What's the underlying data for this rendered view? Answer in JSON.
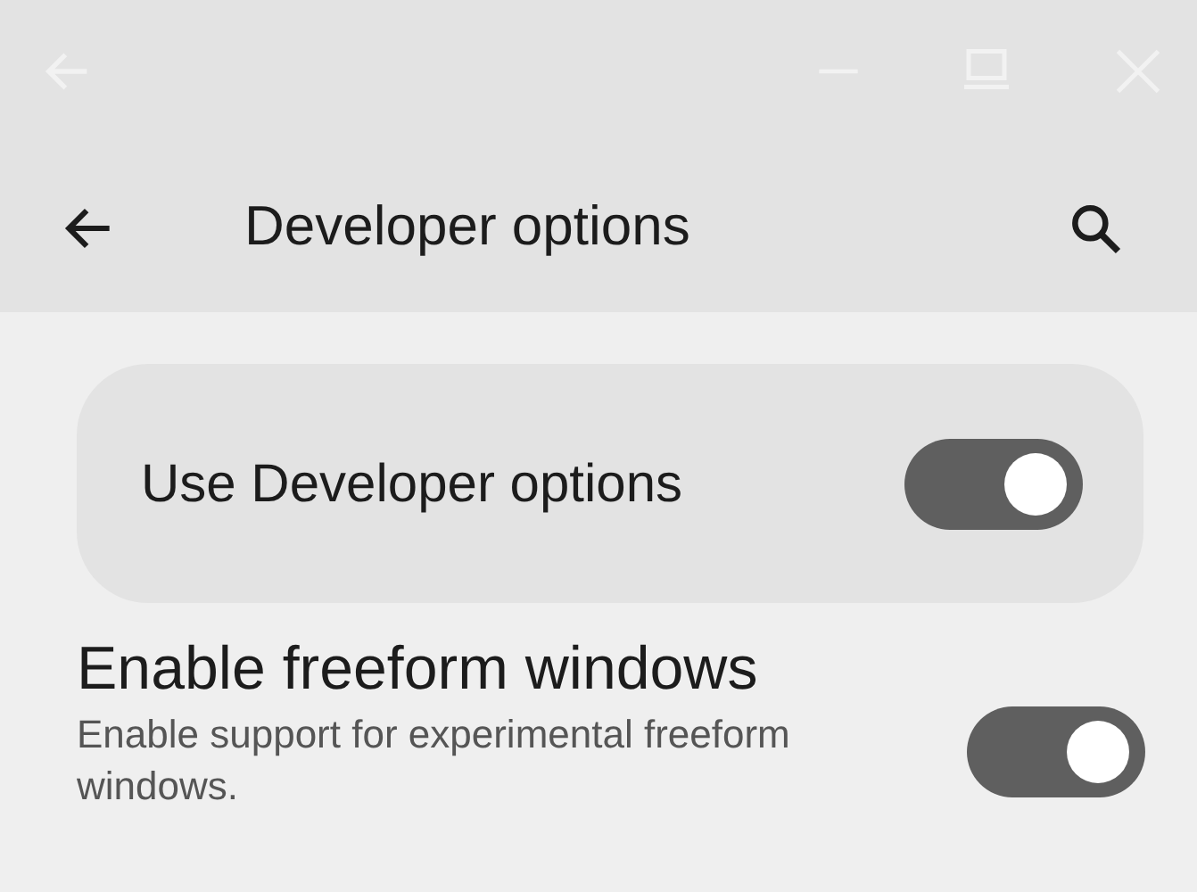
{
  "app_bar": {
    "title": "Developer options"
  },
  "main_switch": {
    "label": "Use Developer options",
    "on": true
  },
  "settings": [
    {
      "title": "Enable freeform windows",
      "summary": "Enable support for experimental freeform windows.",
      "on": true
    }
  ]
}
